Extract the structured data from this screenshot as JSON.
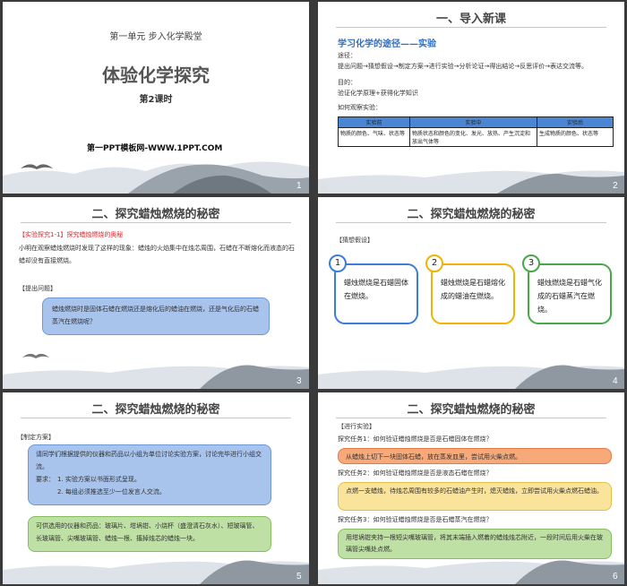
{
  "slide1": {
    "unit": "第一单元  步入化学殿堂",
    "title": "体验化学探究",
    "lesson": "第2课时",
    "site": "第一PPT模板网-WWW.1PPT.COM",
    "num": "1"
  },
  "slide2": {
    "heading": "一、导入新课",
    "subtitle": "学习化学的途径——实验",
    "route_label": "途径：",
    "route_steps": "提出问题→猜想假设→制定方案→进行实验→分析论证→得出结论→反思评价→表达交流等。",
    "goal_label": "目的：",
    "goal": "验证化学原理+获得化学知识",
    "observe_label": "如何观察实验：",
    "table_headers": [
      "实验前",
      "实验中",
      "实验后"
    ],
    "table_cells": [
      "物质的颜色、气味、状态等",
      "物质状态和颜色的变化、发光、放热、产生沉淀和放出气体等",
      "生成物质的颜色、状态等"
    ],
    "num": "2",
    "tag": "询"
  },
  "slide3": {
    "heading": "二、探究蜡烛燃烧的秘密",
    "inquiry_label": "【实验探究1-1】",
    "inquiry_title": "探究蜡烛燃烧的奥秘",
    "desc": "小明在观察蜡烛燃烧时发现了这样的现象：蜡烛的火焰集中在烛芯周围，石蜡在不断熔化而液态的石蜡却没有直接燃烧。",
    "question_label": "【提出问题】",
    "question": "蜡烛燃烧时是固体石蜡在燃烧还是熔化后的蜡油在燃烧，还是气化后的石蜡蒸汽在燃烧呢？",
    "num": "3"
  },
  "slide4": {
    "heading": "二、探究蜡烛燃烧的秘密",
    "label": "【猜想假设】",
    "hypotheses": [
      {
        "n": "1",
        "text": "蜡烛燃烧是石蜡固体在燃烧。",
        "color": "#3b7dd8"
      },
      {
        "n": "2",
        "text": "蜡烛燃烧是石蜡熔化成的蜡油在燃烧。",
        "color": "#f0b400"
      },
      {
        "n": "3",
        "text": "蜡烛燃烧是石蜡气化成的石蜡蒸汽在燃烧。",
        "color": "#48a848"
      }
    ],
    "num": "4"
  },
  "slide5": {
    "heading": "二、探究蜡烛燃烧的秘密",
    "label": "【制定方案】",
    "intro": "请同学们根据提供的仪器和药品以小组为单位讨论实验方案，讨论完毕进行小组交流。",
    "req_label": "要求：",
    "req1": "1. 实验方案以书面形式呈现。",
    "req2": "2. 每组必须推选至少一位发言人交流。",
    "materials": "可供选用的仪器和药品：玻璃片、坩埚钳、小烧杯（盛澄清石灰水）、短玻璃管、长玻璃管、尖嘴玻璃管、蜡烛一根、搐掉烛芯的蜡烛一块。",
    "num": "5"
  },
  "slide6": {
    "heading": "二、探究蜡烛燃烧的秘密",
    "label": "【进行实验】",
    "task1": "探究任务1：如何验证蜡烛燃烧是否是石蜡固体在燃烧？",
    "answer1": "从蜡烛上切下一块固体石蜡，放在蒸发皿里，尝试用火柴点燃。",
    "task2": "探究任务2：如何验证蜡烛燃烧是否是液态石蜡在燃烧？",
    "answer2": "点燃一支蜡烛，待烛芯周围有较多的石蜡油产生时，熄灭蜡烛，立即尝试用火柴点燃石蜡油。",
    "task3": "探究任务3：如何验证蜡烛燃烧是否是石蜡蒸汽在燃烧？",
    "answer3": "用坩埚钳夹持一根短尖嘴玻璃管，将其末端插入燃着的蜡烛烛芯附近，一段时间后用火柴在玻璃管尖嘴处点燃。",
    "num": "6",
    "tag": "询"
  },
  "colors": {
    "red": "#d9282d",
    "blue": "#2f6fc6",
    "pill_blue": "#a9c4ec",
    "pill_green": "#bfe0a4",
    "pill_orange": "#f7a97a",
    "pill_yellow": "#fae39a"
  }
}
